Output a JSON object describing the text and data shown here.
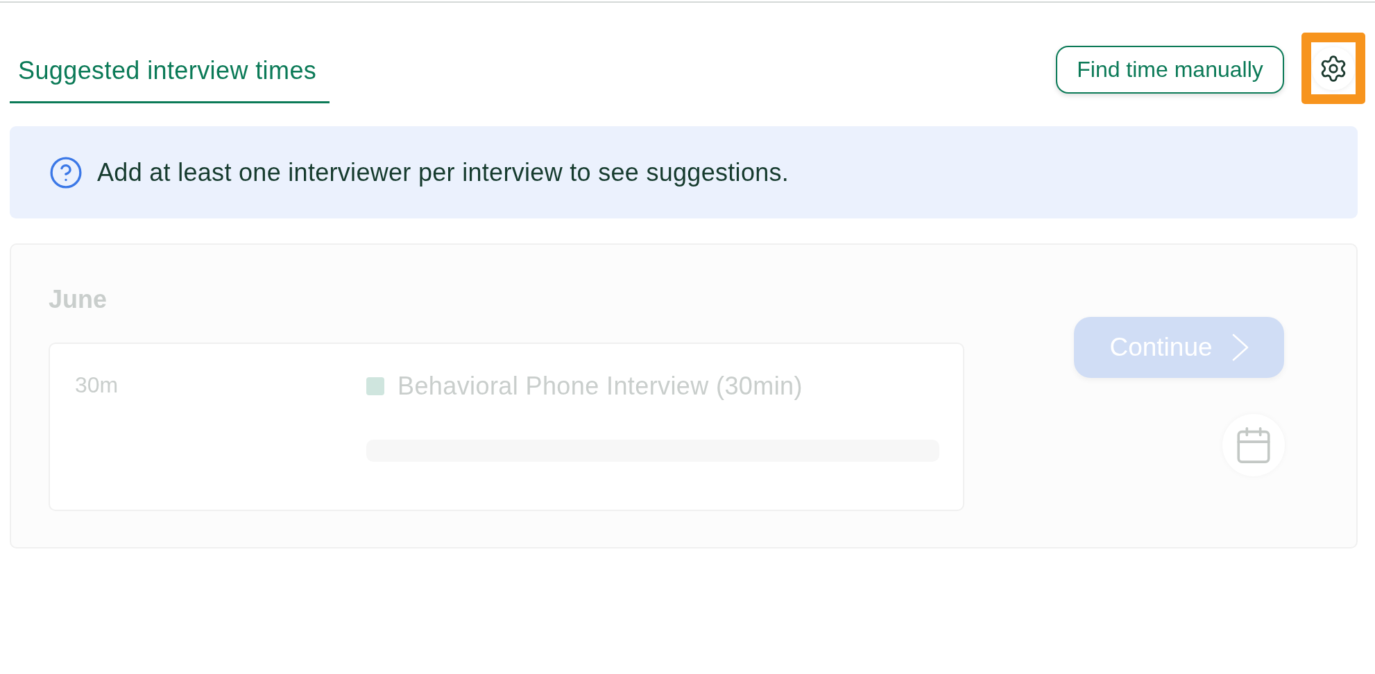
{
  "tabs": [
    {
      "label": "Suggested interview times",
      "selected": true
    }
  ],
  "actions": {
    "find_time_button": {
      "label": "Find time manually"
    },
    "settings_button": {
      "highlighted": true
    }
  },
  "notice": {
    "text": "Add at least one interviewer per interview to see suggestions."
  },
  "suggestions": {
    "disabled": true,
    "month": "June",
    "slots": [
      {
        "duration": "30m",
        "interviews": [
          {
            "title": "Behavioral Phone Interview (30min)",
            "color": "#cfe5de"
          }
        ]
      }
    ],
    "continue_button": {
      "label": "Continue"
    }
  }
}
